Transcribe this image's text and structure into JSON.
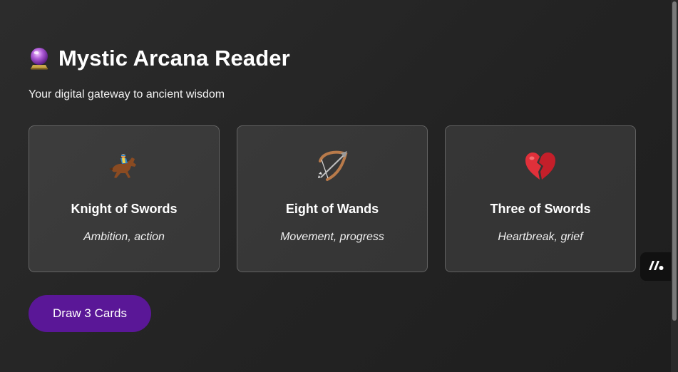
{
  "header": {
    "title": "Mystic Arcana Reader",
    "subtitle": "Your digital gateway to ancient wisdom",
    "icon": "crystal-ball-icon"
  },
  "cards": [
    {
      "name": "Knight of Swords",
      "meaning": "Ambition, action",
      "icon": "horse-racing-icon"
    },
    {
      "name": "Eight of Wands",
      "meaning": "Movement, progress",
      "icon": "bow-and-arrow-icon"
    },
    {
      "name": "Three of Swords",
      "meaning": "Heartbreak, grief",
      "icon": "broken-heart-icon"
    }
  ],
  "actions": {
    "draw_label": "Draw 3 Cards"
  },
  "widget": {
    "icon": "app-logo-icon"
  },
  "colors": {
    "background": "#262626",
    "card_background": "#3a3a3a",
    "button": "#5a1797"
  }
}
